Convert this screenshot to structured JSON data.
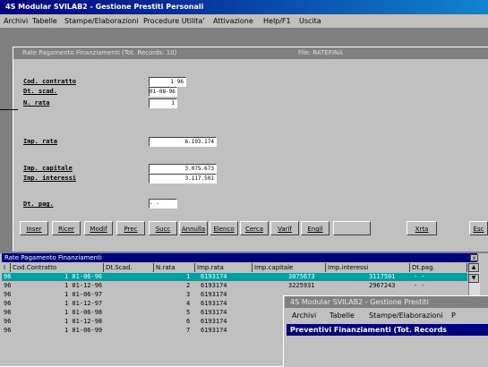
{
  "app": {
    "title": "4S Modular SVILAB2 - Gestione Prestiti Personali",
    "menu": [
      "Archivi",
      "Tabelle",
      "Stampe/Elaborazioni",
      "Procedure Utilita'",
      "Attivazione",
      "Help/F1",
      "Uscita"
    ]
  },
  "form": {
    "title": "Rate Pagamento Finanziamenti (Tot. Records: 10)",
    "file_label": "File: RATEFINA",
    "fields": [
      {
        "label": "Cod. contratto",
        "value": "1  96"
      },
      {
        "label": "Dt. scad.",
        "value": "01-08-96"
      },
      {
        "label": "N. rata",
        "value": "1"
      },
      {
        "label": "Imp. rata",
        "value": "6.193.174"
      },
      {
        "label": "Imp. capitale",
        "value": "3.075.673"
      },
      {
        "label": "Imp. interessi",
        "value": "3.117.501"
      },
      {
        "label": "Dt. pag.",
        "value": "- -"
      }
    ],
    "buttons": [
      "Inser",
      "Ricer",
      "Modif",
      "Prec",
      "Succ",
      "Annulla",
      "Elenco",
      "Cerca",
      "Varif",
      "Engil",
      "Xrta",
      "Esc"
    ]
  },
  "grid": {
    "title": "Rate Pagamento Finanziamenti",
    "close_label": "x",
    "columns": [
      "I",
      "Cod.Contratto",
      "Dt.Scad.",
      "N.rata",
      "Imp.rata",
      "Imp.capitale",
      "Imp.interessi",
      "Dt.pag."
    ],
    "rows": [
      {
        "code": "96",
        "date": "1 01-06-96",
        "n": "1",
        "rata": "6193174",
        "cap": "3075673",
        "int": "3117501",
        "pag": "- -"
      },
      {
        "code": "96",
        "date": "1 01-12-96",
        "n": "2",
        "rata": "6193174",
        "cap": "3225931",
        "int": "2967243",
        "pag": "- -"
      },
      {
        "code": "96",
        "date": "1 01-06-97",
        "n": "3",
        "rata": "6193174",
        "cap": "",
        "int": "",
        "pag": ""
      },
      {
        "code": "96",
        "date": "1 01-12-97",
        "n": "4",
        "rata": "6193174",
        "cap": "",
        "int": "",
        "pag": ""
      },
      {
        "code": "96",
        "date": "1 01-06-98",
        "n": "5",
        "rata": "6193174",
        "cap": "",
        "int": "",
        "pag": ""
      },
      {
        "code": "96",
        "date": "1 01-12-98",
        "n": "6",
        "rata": "6193174",
        "cap": "",
        "int": "",
        "pag": ""
      },
      {
        "code": "96",
        "date": "1 01-06-99",
        "n": "7",
        "rata": "6193174",
        "cap": "",
        "int": "",
        "pag": ""
      }
    ]
  },
  "second_window": {
    "title": "4S Modular SVILAB2 - Gestione Prestiti",
    "menu": [
      "Archivi",
      "Tabelle",
      "Stampe/Elaborazioni",
      "P"
    ],
    "subtitle": "Preventivi Finanziamenti (Tot. Records"
  },
  "colors": {
    "title_active": "#000080",
    "title_inactive": "#808080",
    "selected_row": "#00a0a0",
    "face": "#c0c0c0"
  }
}
